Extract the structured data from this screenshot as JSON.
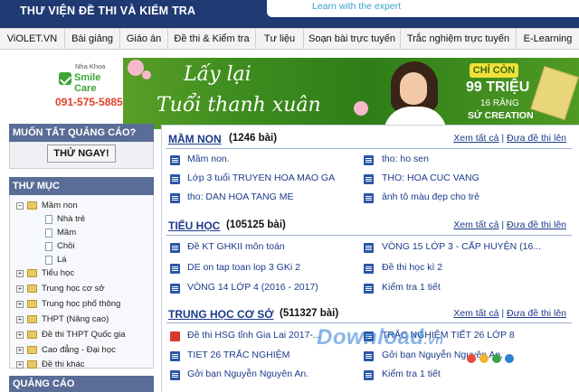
{
  "header": {
    "site_title": "THƯ VIỆN ĐỀ THI VÀ KIỂM TRA",
    "tagline": "Learn with the expert"
  },
  "nav": {
    "items": [
      "ViOLET.VN",
      "Bài giảng",
      "Giáo án",
      "Đề thi & Kiểm tra",
      "Tư liệu",
      "Soạn bài trực tuyến",
      "Trắc nghiệm trực tuyến",
      "E-Learning"
    ]
  },
  "banner": {
    "brand_small": "Nha Khoa",
    "brand_name": "Smile Care",
    "brand_phone": "091-575-5885",
    "slogan_line1": "Lấy lại",
    "slogan_line2": "Tuổi thanh xuân",
    "offer_badge": "CHỈ CÒN",
    "offer_amount": "99 TRIỆU",
    "offer_sub": "16 RĂNG",
    "offer_sub2": "SỨ CREATION"
  },
  "sidebar": {
    "ads_title": "MUỐN TẮT QUẢNG CÁO?",
    "ads_button": "THỬ NGAY!",
    "dir_title": "THƯ MỤC",
    "tree": [
      {
        "label": "Mầm non",
        "toggle": "−",
        "children": [
          "Nhà trẻ",
          "Mầm",
          "Chồi",
          "Lá"
        ]
      },
      {
        "label": "Tiểu học",
        "toggle": "+"
      },
      {
        "label": "Trung học cơ sở",
        "toggle": "+"
      },
      {
        "label": "Trung học phổ thông",
        "toggle": "+"
      },
      {
        "label": "THPT (Nâng cao)",
        "toggle": "+"
      },
      {
        "label": "Đề thi THPT Quốc gia",
        "toggle": "+"
      },
      {
        "label": "Cao đẳng - Đại học",
        "toggle": "+"
      },
      {
        "label": "Đề thi khác",
        "toggle": "+"
      }
    ],
    "ad_footer_title": "QUẢNG CÁO"
  },
  "sections": [
    {
      "title": "MẦM NON",
      "count": "(1246 bài)",
      "see_all": "Xem tất cả",
      "upload": "Đưa đề thi lên",
      "items": [
        [
          "Mầm non.",
          "tho: ho sen"
        ],
        [
          "Lớp 3 tuổi TRUYEN HOA MAO GA",
          "THO: HOA CUC VANG"
        ],
        [
          "tho: DAN HOA TANG ME",
          "ảnh tô màu đẹp cho trẻ"
        ]
      ]
    },
    {
      "title": "TIỂU HỌC",
      "count": "(105125 bài)",
      "see_all": "Xem tất cả",
      "upload": "Đưa đề thi lên",
      "items": [
        [
          "Đề KT GHKII môn toán",
          "VÒNG 15 LỚP 3 - CẤP HUYỆN (16..."
        ],
        [
          "DE on tap toan lop 3 GKi 2",
          "Đề thi học kì 2"
        ],
        [
          "VÒNG 14 LỚP 4 (2016 - 2017)",
          "Kiểm tra 1 tiết"
        ]
      ]
    },
    {
      "title": "TRUNG HỌC CƠ SỞ",
      "count": "(511327 bài)",
      "see_all": "Xem tất cả",
      "upload": "Đưa đề thi lên",
      "items": [
        [
          "Đề thi HSG tỉnh Gia Lai 2017-...",
          "TRẮC NGHIỆM TIẾT 26 LỚP 8"
        ],
        [
          "TIET 26 TRẮC NGHIỆM",
          "Gởi bạn Nguyễn Nguyên An."
        ],
        [
          "Gởi bạn Nguyễn Nguyên An.",
          "Kiểm tra 1 tiết"
        ]
      ]
    }
  ],
  "watermark": {
    "main": "Download",
    "suffix": ".vn"
  },
  "colors": {
    "header_bg": "#1f3a72",
    "sidebar_head": "#5a6d96",
    "link": "#1b3a8a",
    "banner_green": "#3f8d1f"
  }
}
